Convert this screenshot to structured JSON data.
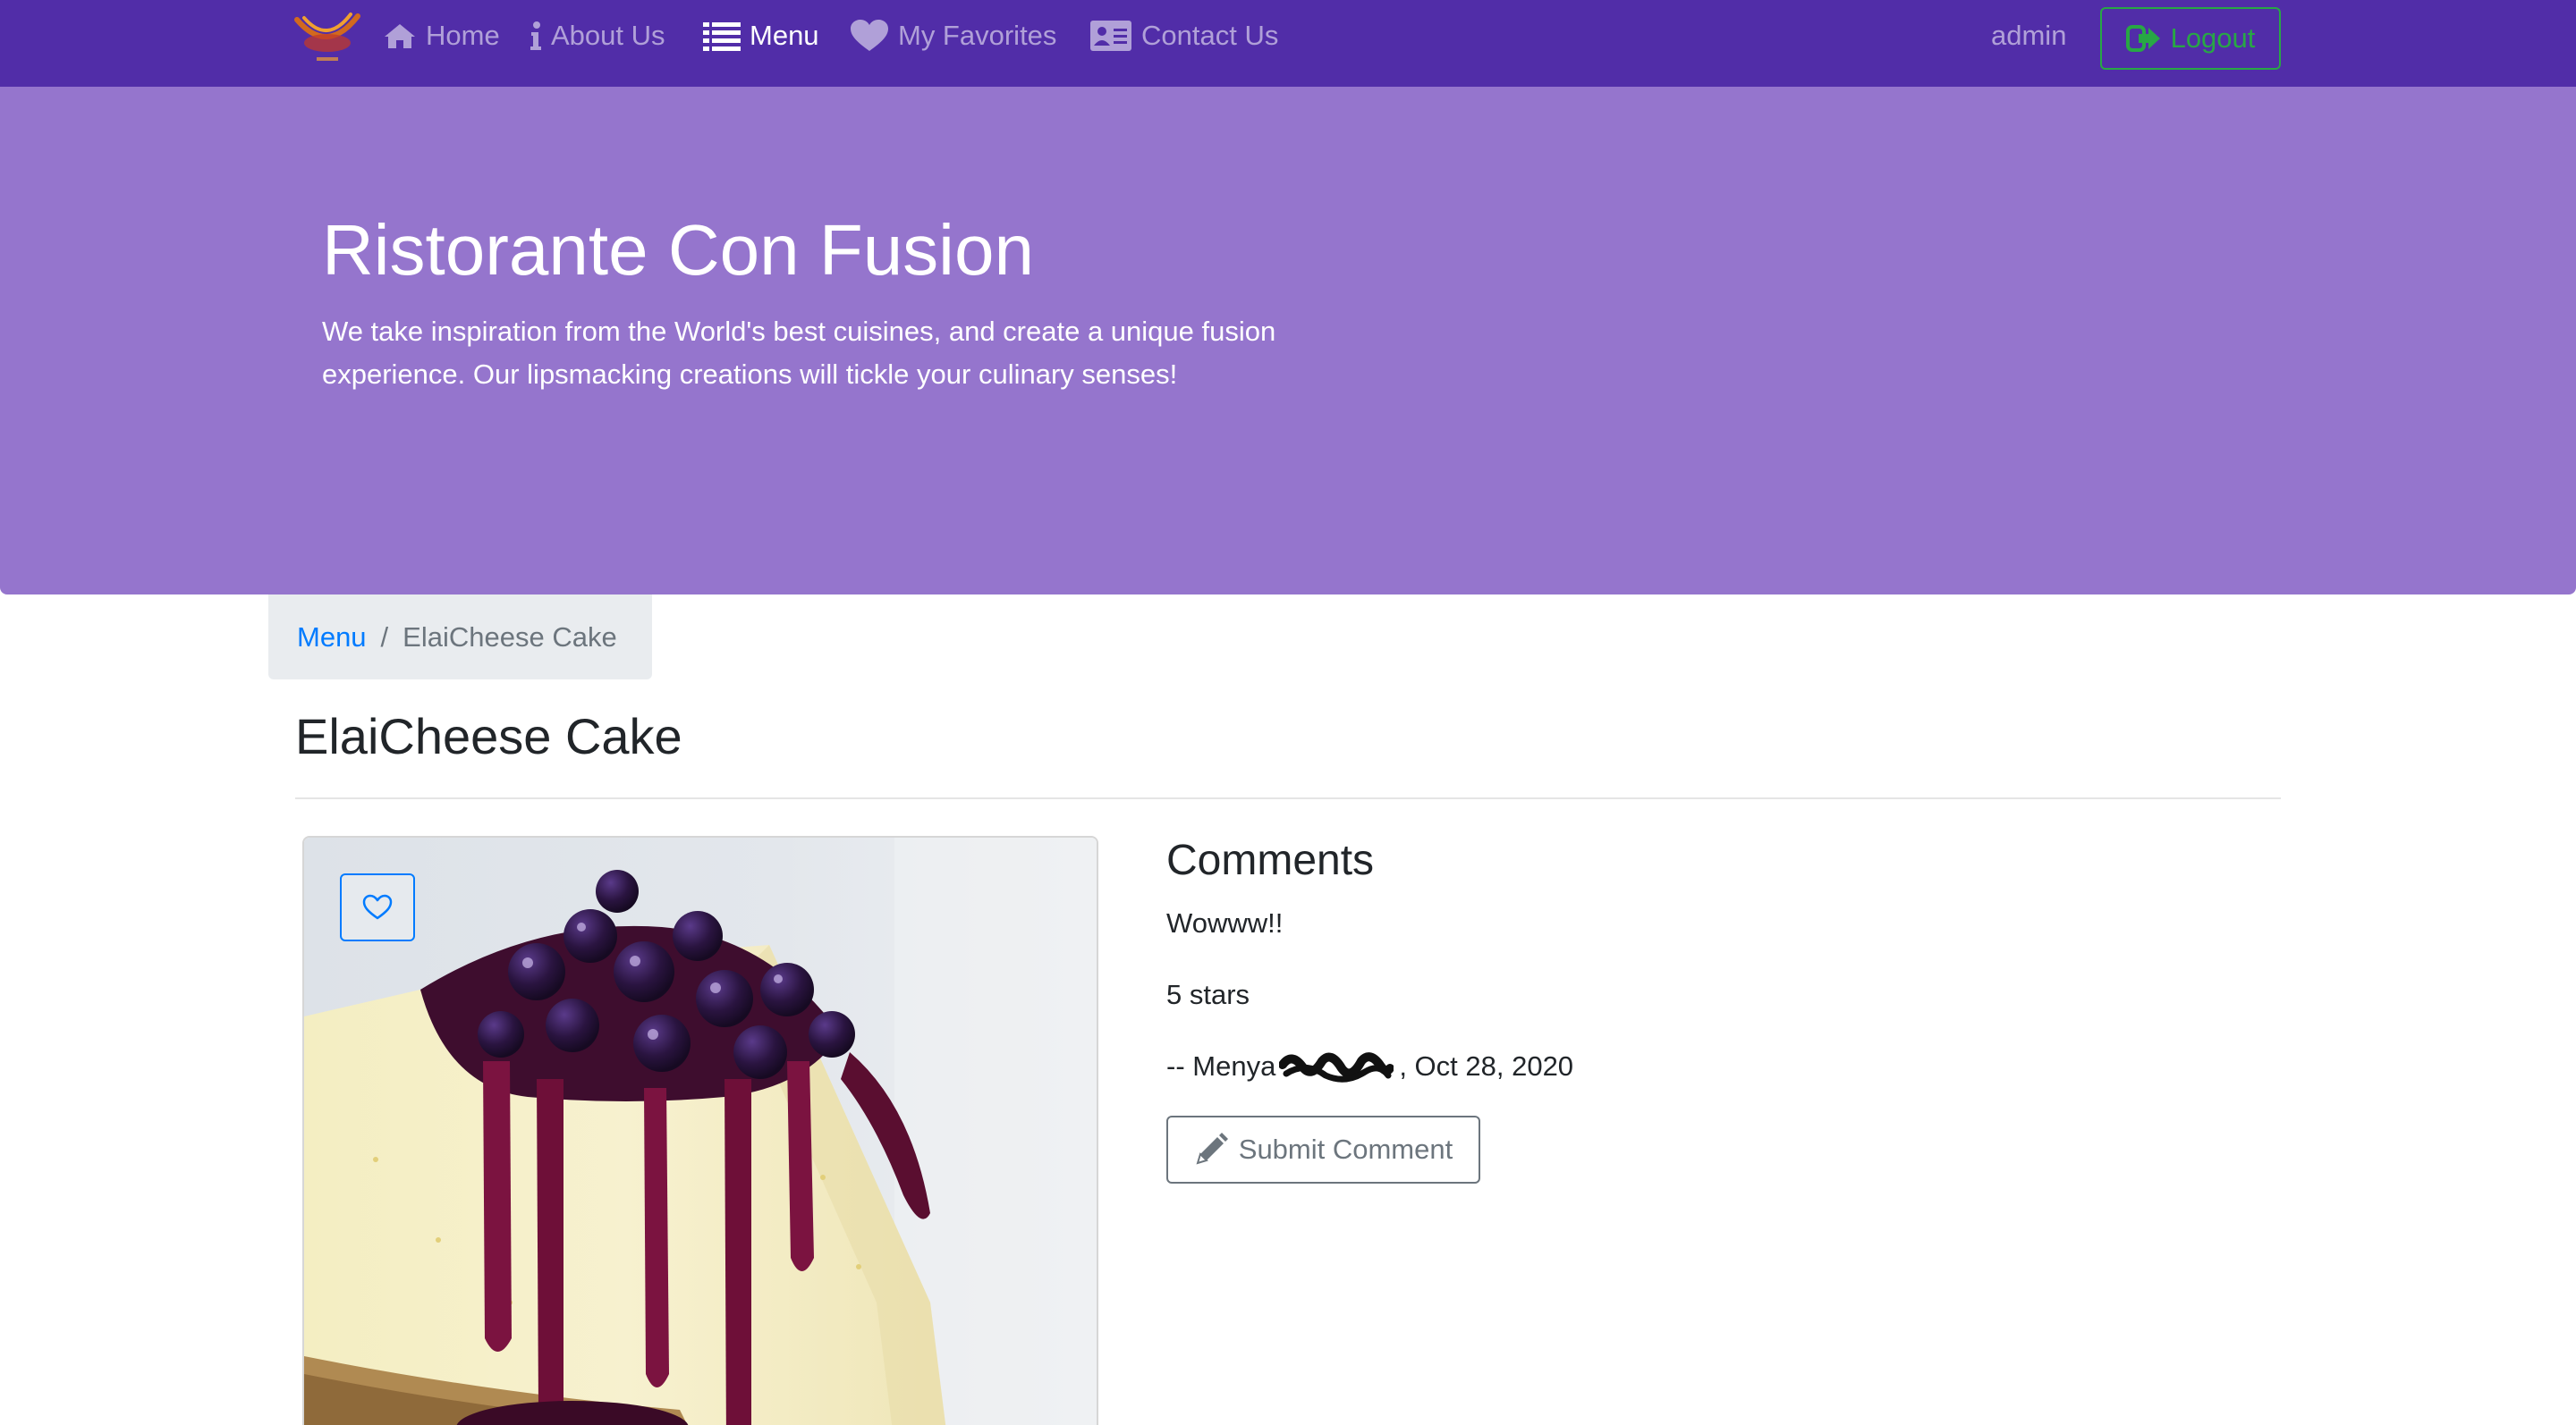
{
  "navbar": {
    "brand_icon": "restaurant-logo",
    "items": [
      {
        "label": "Home",
        "icon": "home-icon",
        "active": false
      },
      {
        "label": "About Us",
        "icon": "info-icon",
        "active": false
      },
      {
        "label": "Menu",
        "icon": "list-icon",
        "active": true
      },
      {
        "label": "My Favorites",
        "icon": "heart-icon",
        "active": false
      },
      {
        "label": "Contact Us",
        "icon": "address-card-icon",
        "active": false
      }
    ],
    "user": "admin",
    "logout_label": "Logout",
    "logout_icon": "sign-out-icon"
  },
  "jumbotron": {
    "title": "Ristorante Con Fusion",
    "text": "We take inspiration from the World's best cuisines, and create a unique fusion experience. Our lipsmacking creations will tickle your culinary senses!"
  },
  "breadcrumb": {
    "link": "Menu",
    "separator": "/",
    "current": "ElaiCheese Cake"
  },
  "dish": {
    "name": "ElaiCheese Cake",
    "image": "blueberry-cheesecake-photo",
    "favorite_icon": "heart-outline-icon",
    "favorited": false
  },
  "comments": {
    "heading": "Comments",
    "items": [
      {
        "comment": "Wowww!!",
        "rating": "5 stars",
        "author_prefix": "-- Menya",
        "date_suffix": ", Oct 28, 2020"
      }
    ],
    "submit_label": "Submit Comment",
    "submit_icon": "pencil-icon"
  },
  "colors": {
    "primary_dark": "#512DA8",
    "primary_light": "#9575CD",
    "link": "#007bff",
    "success": "#28a745",
    "secondary": "#6c757d"
  }
}
